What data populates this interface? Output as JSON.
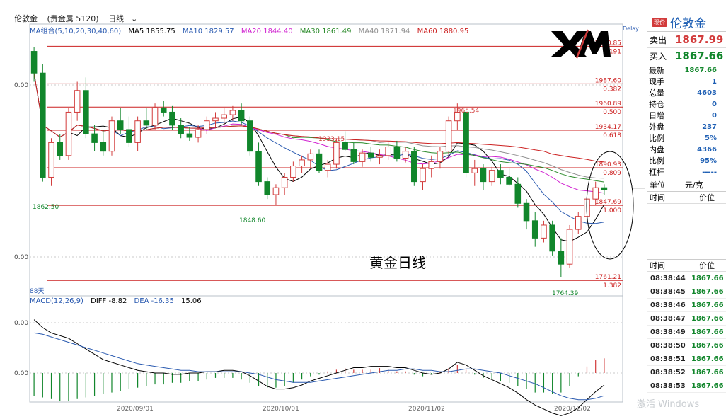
{
  "header": {
    "title": "伦敦金",
    "category": "(贵金属 5120)",
    "period": "日线"
  },
  "ma_legend": {
    "group": "MA组合(5,10,20,30,40,60)",
    "ma5": "MA5 1855.75",
    "ma10": "MA10 1829.57",
    "ma20": "MA20 1844.40",
    "ma30": "MA30 1861.49",
    "ma40": "MA40 1871.94",
    "ma60": "MA60 1880.95"
  },
  "macd_legend": {
    "name": "MACD(12,26,9)",
    "diff": "DIFF -8.82",
    "dea": "DEA -16.35",
    "macd": "15.06"
  },
  "delay_label": "Delay",
  "logo_text": "XM",
  "chart_label": "黄金日线",
  "days_label": "88天",
  "colors": {
    "up": "#d23b3b",
    "down": "#11862b",
    "ma5": "#000000",
    "ma10": "#2a5ab0",
    "ma20": "#d020d0",
    "ma30": "#2a8a2a",
    "ma40": "#909090",
    "ma60": "#cc2020",
    "fib": "#cc2020"
  },
  "chart_data": {
    "type": "candlestick",
    "price_axis_labels": [
      "0.00",
      "0.00"
    ],
    "macd_axis_labels": [
      "0.00",
      "0.00"
    ],
    "date_labels": [
      "2020/09/01",
      "2020/10/01",
      "2020/11/02",
      "2020/12/02"
    ],
    "annotations": [
      {
        "text": "1862.50",
        "value": 1862.5
      },
      {
        "text": "1848.60",
        "value": 1848.6
      },
      {
        "text": "1933.15",
        "value": 1933.15
      },
      {
        "text": "1965.54",
        "value": 1965.54
      },
      {
        "text": "1764.39",
        "value": 1764.39
      }
    ],
    "fib_levels": [
      {
        "price": "2030.85",
        "ratio": "0.191",
        "value": 2030.85
      },
      {
        "price": "1987.60",
        "ratio": "0.382",
        "value": 1987.6
      },
      {
        "price": "1960.89",
        "ratio": "0.500",
        "value": 1960.89
      },
      {
        "price": "1934.17",
        "ratio": "0.618",
        "value": 1934.17
      },
      {
        "price": "1890.93",
        "ratio": "0.809",
        "value": 1890.93
      },
      {
        "price": "1847.69",
        "ratio": "1.000",
        "value": 1847.69
      },
      {
        "price": "1761.21",
        "ratio": "1.382",
        "value": 1761.21
      }
    ],
    "candles": [
      [
        2025,
        2030,
        1990,
        2000
      ],
      [
        2000,
        2010,
        1875,
        1880
      ],
      [
        1880,
        1925,
        1870,
        1920
      ],
      [
        1920,
        1930,
        1900,
        1905
      ],
      [
        1905,
        1960,
        1900,
        1955
      ],
      [
        1955,
        1990,
        1945,
        1980
      ],
      [
        1980,
        1995,
        1925,
        1930
      ],
      [
        1930,
        1940,
        1910,
        1920
      ],
      [
        1920,
        1935,
        1905,
        1910
      ],
      [
        1910,
        1950,
        1905,
        1945
      ],
      [
        1945,
        1960,
        1930,
        1935
      ],
      [
        1935,
        1950,
        1915,
        1920
      ],
      [
        1920,
        1950,
        1910,
        1945
      ],
      [
        1945,
        1960,
        1935,
        1940
      ],
      [
        1940,
        1965,
        1935,
        1960
      ],
      [
        1960,
        1968,
        1950,
        1955
      ],
      [
        1955,
        1962,
        1935,
        1940
      ],
      [
        1940,
        1948,
        1925,
        1930
      ],
      [
        1930,
        1938,
        1922,
        1926
      ],
      [
        1926,
        1940,
        1920,
        1935
      ],
      [
        1935,
        1950,
        1930,
        1945
      ],
      [
        1945,
        1955,
        1938,
        1948
      ],
      [
        1948,
        1960,
        1940,
        1952
      ],
      [
        1952,
        1962,
        1945,
        1957
      ],
      [
        1957,
        1965,
        1940,
        1945
      ],
      [
        1945,
        1950,
        1905,
        1910
      ],
      [
        1910,
        1920,
        1870,
        1875
      ],
      [
        1875,
        1880,
        1855,
        1860
      ],
      [
        1860,
        1872,
        1848,
        1868
      ],
      [
        1868,
        1885,
        1860,
        1880
      ],
      [
        1880,
        1898,
        1875,
        1893
      ],
      [
        1893,
        1905,
        1885,
        1900
      ],
      [
        1900,
        1912,
        1890,
        1907
      ],
      [
        1907,
        1912,
        1885,
        1888
      ],
      [
        1888,
        1900,
        1880,
        1895
      ],
      [
        1895,
        1925,
        1890,
        1920
      ],
      [
        1920,
        1933,
        1910,
        1912
      ],
      [
        1912,
        1920,
        1895,
        1898
      ],
      [
        1898,
        1912,
        1892,
        1908
      ],
      [
        1908,
        1915,
        1898,
        1903
      ],
      [
        1903,
        1912,
        1895,
        1905
      ],
      [
        1905,
        1920,
        1900,
        1915
      ],
      [
        1915,
        1922,
        1898,
        1902
      ],
      [
        1902,
        1915,
        1897,
        1910
      ],
      [
        1910,
        1915,
        1870,
        1875
      ],
      [
        1875,
        1895,
        1865,
        1890
      ],
      [
        1890,
        1905,
        1880,
        1898
      ],
      [
        1898,
        1915,
        1890,
        1910
      ],
      [
        1910,
        1950,
        1905,
        1945
      ],
      [
        1945,
        1965,
        1935,
        1955
      ],
      [
        1955,
        1960,
        1880,
        1885
      ],
      [
        1885,
        1900,
        1870,
        1890
      ],
      [
        1890,
        1895,
        1865,
        1875
      ],
      [
        1875,
        1892,
        1870,
        1888
      ],
      [
        1888,
        1895,
        1872,
        1880
      ],
      [
        1880,
        1890,
        1870,
        1872
      ],
      [
        1872,
        1880,
        1845,
        1850
      ],
      [
        1850,
        1855,
        1820,
        1830
      ],
      [
        1830,
        1840,
        1800,
        1810
      ],
      [
        1810,
        1830,
        1805,
        1825
      ],
      [
        1825,
        1830,
        1790,
        1795
      ],
      [
        1795,
        1810,
        1765,
        1780
      ],
      [
        1780,
        1825,
        1776,
        1820
      ],
      [
        1820,
        1840,
        1815,
        1835
      ],
      [
        1835,
        1860,
        1830,
        1855
      ],
      [
        1855,
        1875,
        1848,
        1868
      ],
      [
        1868,
        1872,
        1860,
        1866
      ]
    ],
    "macd_hist": [
      -14,
      -15,
      -16,
      -17,
      -17,
      -16,
      -15,
      -14,
      -13,
      -12,
      -11,
      -10,
      -9,
      -8,
      -7,
      -7,
      -6,
      -6,
      -5,
      -5,
      -4,
      -3,
      -3,
      -3,
      -4,
      -6,
      -8,
      -9,
      -9,
      -8,
      -6,
      -4,
      -2,
      -1,
      1,
      2,
      3,
      2,
      2,
      2,
      3,
      2,
      1,
      1,
      -1,
      -2,
      -1,
      1,
      3,
      5,
      2,
      -1,
      -3,
      -4,
      -5,
      -6,
      -8,
      -10,
      -12,
      -12,
      -13,
      -12,
      -8,
      -2,
      4,
      8,
      9
    ],
    "macd_diff": [
      40,
      34,
      30,
      28,
      26,
      22,
      18,
      14,
      10,
      8,
      6,
      4,
      2,
      1,
      0,
      0,
      -1,
      -1,
      0,
      0,
      1,
      1,
      2,
      2,
      1,
      -2,
      -6,
      -10,
      -12,
      -12,
      -11,
      -9,
      -6,
      -4,
      -2,
      0,
      2,
      4,
      4,
      5,
      5,
      5,
      4,
      4,
      2,
      0,
      -1,
      0,
      3,
      8,
      6,
      2,
      -2,
      -5,
      -8,
      -11,
      -15,
      -20,
      -24,
      -27,
      -30,
      -32,
      -30,
      -26,
      -20,
      -14,
      -9
    ],
    "macd_dea": [
      30,
      29,
      27,
      25,
      23,
      21,
      19,
      17,
      15,
      13,
      11,
      9,
      7,
      6,
      5,
      4,
      3,
      2,
      2,
      1,
      1,
      1,
      1,
      1,
      1,
      0,
      -1,
      -3,
      -5,
      -6,
      -7,
      -7,
      -7,
      -6,
      -5,
      -4,
      -3,
      -2,
      -1,
      0,
      1,
      2,
      2,
      3,
      3,
      2,
      2,
      1,
      1,
      2,
      3,
      3,
      2,
      1,
      0,
      -2,
      -4,
      -6,
      -8,
      -11,
      -14,
      -17,
      -19,
      -20,
      -20,
      -19,
      -17
    ]
  },
  "panel": {
    "tag": "现价",
    "name": "伦敦金",
    "sell_label": "卖出",
    "sell_value": "1867.99",
    "buy_label": "买入",
    "buy_value": "1867.66",
    "stats": [
      {
        "label": "最新",
        "value": "1867.66",
        "color": "#11862b"
      },
      {
        "label": "现手",
        "value": "1",
        "color": "#1e5fb4"
      },
      {
        "label": "总量",
        "value": "4603",
        "color": "#1e5fb4"
      },
      {
        "label": "持仓",
        "value": "0",
        "color": "#1e5fb4"
      },
      {
        "label": "日增",
        "value": "0",
        "color": "#1e5fb4"
      },
      {
        "label": "外盘",
        "value": "237",
        "color": "#1e5fb4"
      },
      {
        "label": "比例",
        "value": "5%",
        "color": "#1e5fb4"
      },
      {
        "label": "内盘",
        "value": "4366",
        "color": "#1e5fb4"
      },
      {
        "label": "比例",
        "value": "95%",
        "color": "#1e5fb4"
      },
      {
        "label": "杠杆",
        "value": "-----",
        "color": "#1e5fb4"
      }
    ],
    "unit_label": "单位",
    "unit_value": "元/克",
    "time_header": "时间",
    "price_header": "价位",
    "ticks": [
      {
        "time": "08:38:44",
        "price": "1867.66"
      },
      {
        "time": "08:38:45",
        "price": "1867.66"
      },
      {
        "time": "08:38:46",
        "price": "1867.66"
      },
      {
        "time": "08:38:47",
        "price": "1867.66"
      },
      {
        "time": "08:38:49",
        "price": "1867.66"
      },
      {
        "time": "08:38:50",
        "price": "1867.66"
      },
      {
        "time": "08:38:51",
        "price": "1867.66"
      },
      {
        "time": "08:38:52",
        "price": "1867.66"
      },
      {
        "time": "08:38:53",
        "price": "1867.66"
      }
    ]
  },
  "watermark": "激活 Windows"
}
